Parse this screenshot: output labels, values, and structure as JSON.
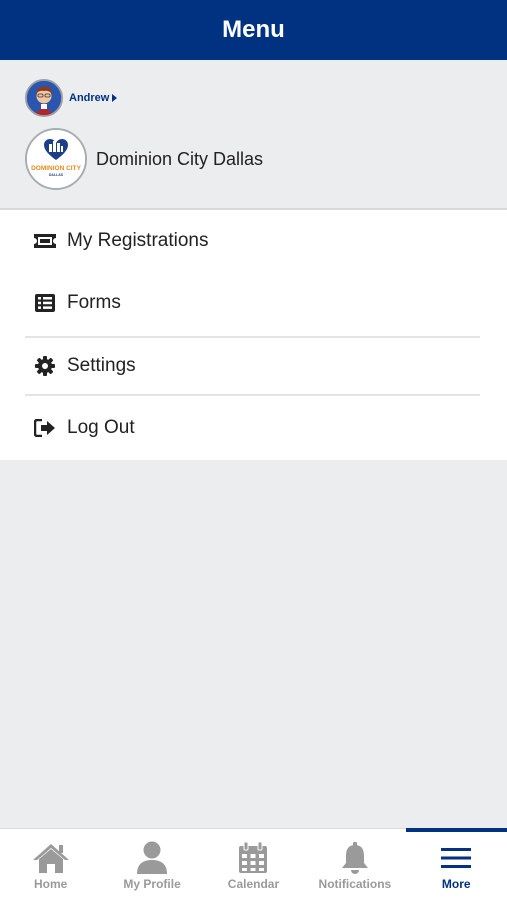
{
  "header": {
    "title": "Menu"
  },
  "profile": {
    "user_name": "Andrew",
    "church_name": "Dominion City Dallas",
    "church_logo_text": "DOMINION CITY",
    "church_logo_subtext": "DALLAS"
  },
  "menu": {
    "items": [
      {
        "label": "My Registrations",
        "icon": "ticket-icon"
      },
      {
        "label": "Forms",
        "icon": "list-icon"
      },
      {
        "label": "Settings",
        "icon": "gear-icon"
      },
      {
        "label": "Log Out",
        "icon": "sign-out-icon"
      }
    ]
  },
  "tabbar": {
    "tabs": [
      {
        "label": "Home",
        "icon": "home-icon"
      },
      {
        "label": "My Profile",
        "icon": "user-icon"
      },
      {
        "label": "Calendar",
        "icon": "calendar-icon"
      },
      {
        "label": "Notifications",
        "icon": "bell-icon"
      },
      {
        "label": "More",
        "icon": "hamburger-icon",
        "active": true
      }
    ]
  },
  "colors": {
    "primary": "#003282",
    "background": "#ecedee",
    "inactive_tab": "#9a9a9a"
  }
}
